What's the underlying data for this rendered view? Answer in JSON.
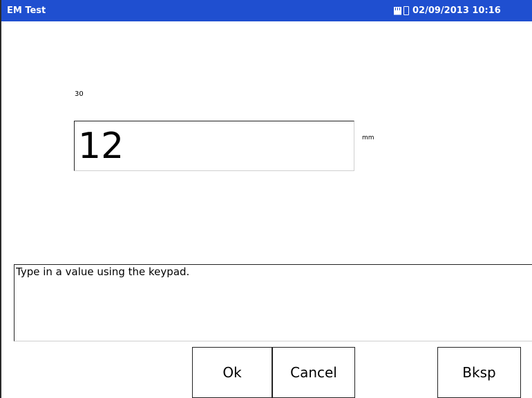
{
  "window": {
    "title": "EM Test",
    "datetime": "02/09/2013 10:16",
    "accent_color": "#1f4fd0"
  },
  "status_icons": [
    "sd-card-icon",
    "battery-icon"
  ],
  "entry": {
    "small_label": "30",
    "value": "12",
    "unit": "mm"
  },
  "message": {
    "text": "Type in a value using the keypad."
  },
  "buttons": {
    "ok": "Ok",
    "cancel": "Cancel",
    "bksp": "Bksp"
  }
}
